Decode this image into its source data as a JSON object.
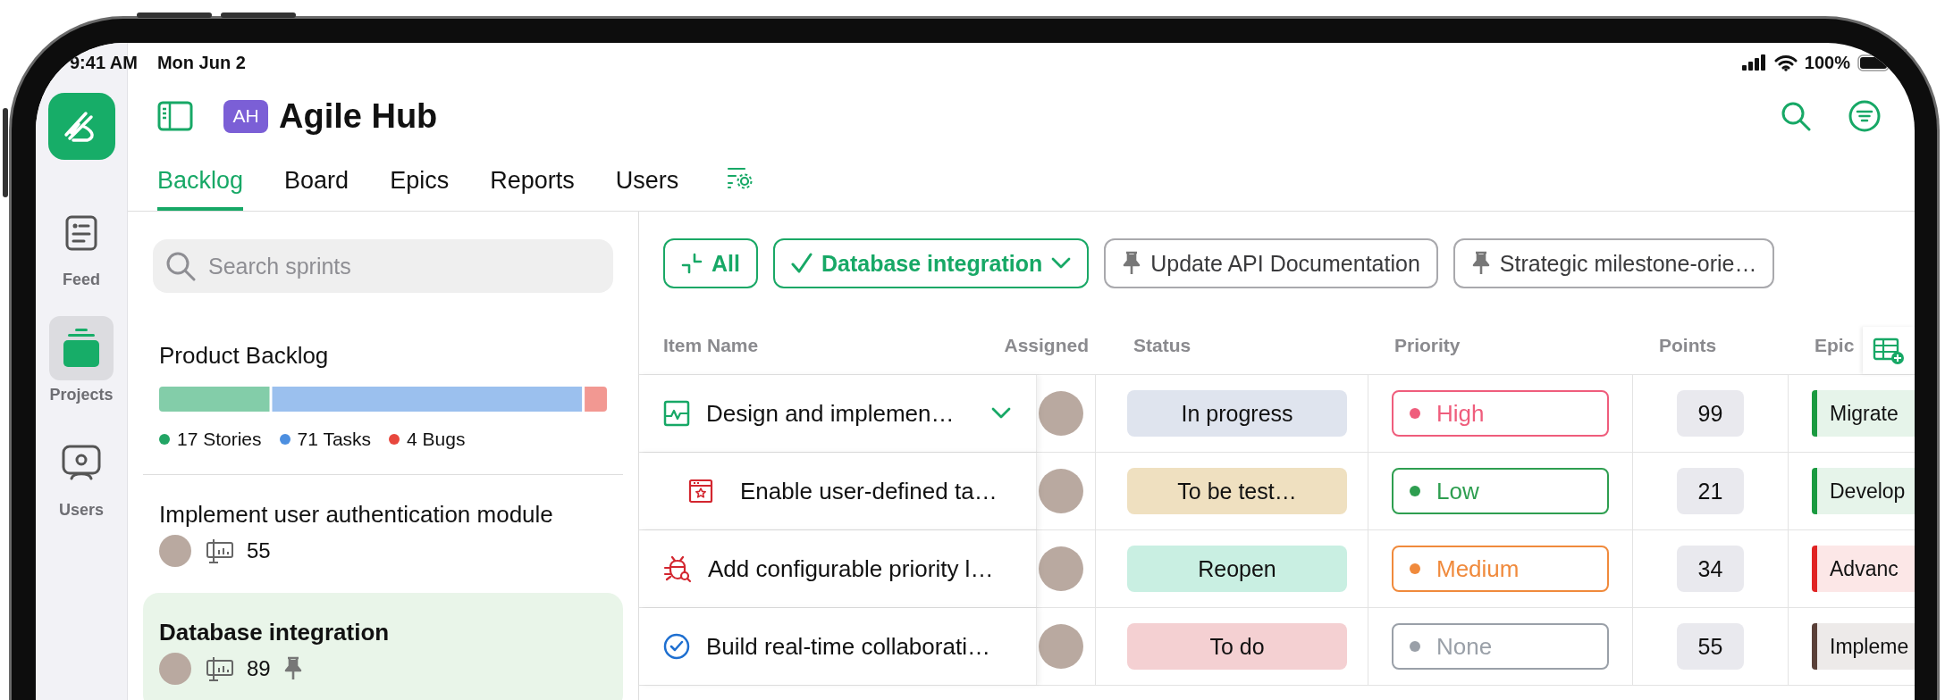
{
  "status_bar": {
    "time": "9:41 AM",
    "date": "Mon Jun 2",
    "battery": "100%"
  },
  "rail": [
    {
      "kind": "feed",
      "label": "Feed",
      "selected": false
    },
    {
      "kind": "projects",
      "label": "Projects",
      "selected": true
    },
    {
      "kind": "users",
      "label": "Users",
      "selected": false
    }
  ],
  "header": {
    "badge": "AH",
    "title": "Agile Hub"
  },
  "tabs": [
    {
      "label": "Backlog",
      "selected": true
    },
    {
      "label": "Board",
      "selected": false
    },
    {
      "label": "Epics",
      "selected": false
    },
    {
      "label": "Reports",
      "selected": false
    },
    {
      "label": "Users",
      "selected": false
    }
  ],
  "search": {
    "placeholder": "Search sprints"
  },
  "sprints": [
    {
      "kind": "backlog",
      "title": "Product Backlog",
      "selected": false,
      "breakdown": [
        {
          "label": "17 Stories",
          "color": "#22a565"
        },
        {
          "label": "71 Tasks",
          "color": "#4d8fe0"
        },
        {
          "label": "4 Bugs",
          "color": "#e8473d"
        }
      ]
    },
    {
      "kind": "sprint",
      "title": "Implement user authentication module",
      "points": "55",
      "pinned": false,
      "selected": false
    },
    {
      "kind": "sprint",
      "title": "Database integration",
      "points": "89",
      "pinned": true,
      "selected": true
    }
  ],
  "filters": [
    {
      "kind": "all",
      "label": "All",
      "selected": true
    },
    {
      "kind": "dropdown",
      "label": "Database integration",
      "selected": true
    },
    {
      "kind": "pinned",
      "label": "Update API Documentation",
      "selected": false
    },
    {
      "kind": "pinned",
      "label": "Strategic milestone-orie…",
      "selected": false
    }
  ],
  "table": {
    "columns": [
      "Item Name",
      "Assigned",
      "Status",
      "Priority",
      "Points",
      "Epic"
    ],
    "rows": [
      {
        "kind": "epic",
        "title": "Design and implemen…",
        "expanded": true,
        "status": {
          "label": "In progress",
          "color": "#dfe4ee"
        },
        "priority": {
          "label": "High",
          "color": "#ef5d7c"
        },
        "points": "99",
        "epic": {
          "label": "Migrate",
          "color": "#1a9a40"
        },
        "children": [
          {
            "kind": "story",
            "title": "Enable user-defined ta…",
            "status": {
              "label": "To be test…",
              "color": "#efe0c0"
            },
            "priority": {
              "label": "Low",
              "color": "#2e9e50"
            },
            "points": "21",
            "epic": {
              "label": "Develop",
              "color": "#1a9a40"
            }
          }
        ]
      },
      {
        "kind": "bug",
        "title": "Add configurable priority l…",
        "status": {
          "label": "Reopen",
          "color": "#c9efe2"
        },
        "priority": {
          "label": "Medium",
          "color": "#f08a3c"
        },
        "points": "34",
        "epic": {
          "label": "Advanc",
          "color": "#e02424"
        }
      },
      {
        "kind": "task",
        "title": "Build real-time collaborati…",
        "status": {
          "label": "To do",
          "color": "#f4d0d2"
        },
        "priority": {
          "label": "None",
          "color": "#9aa0a8"
        },
        "points": "55",
        "epic": {
          "label": "Impleme",
          "color": "#5a4038"
        }
      }
    ]
  }
}
